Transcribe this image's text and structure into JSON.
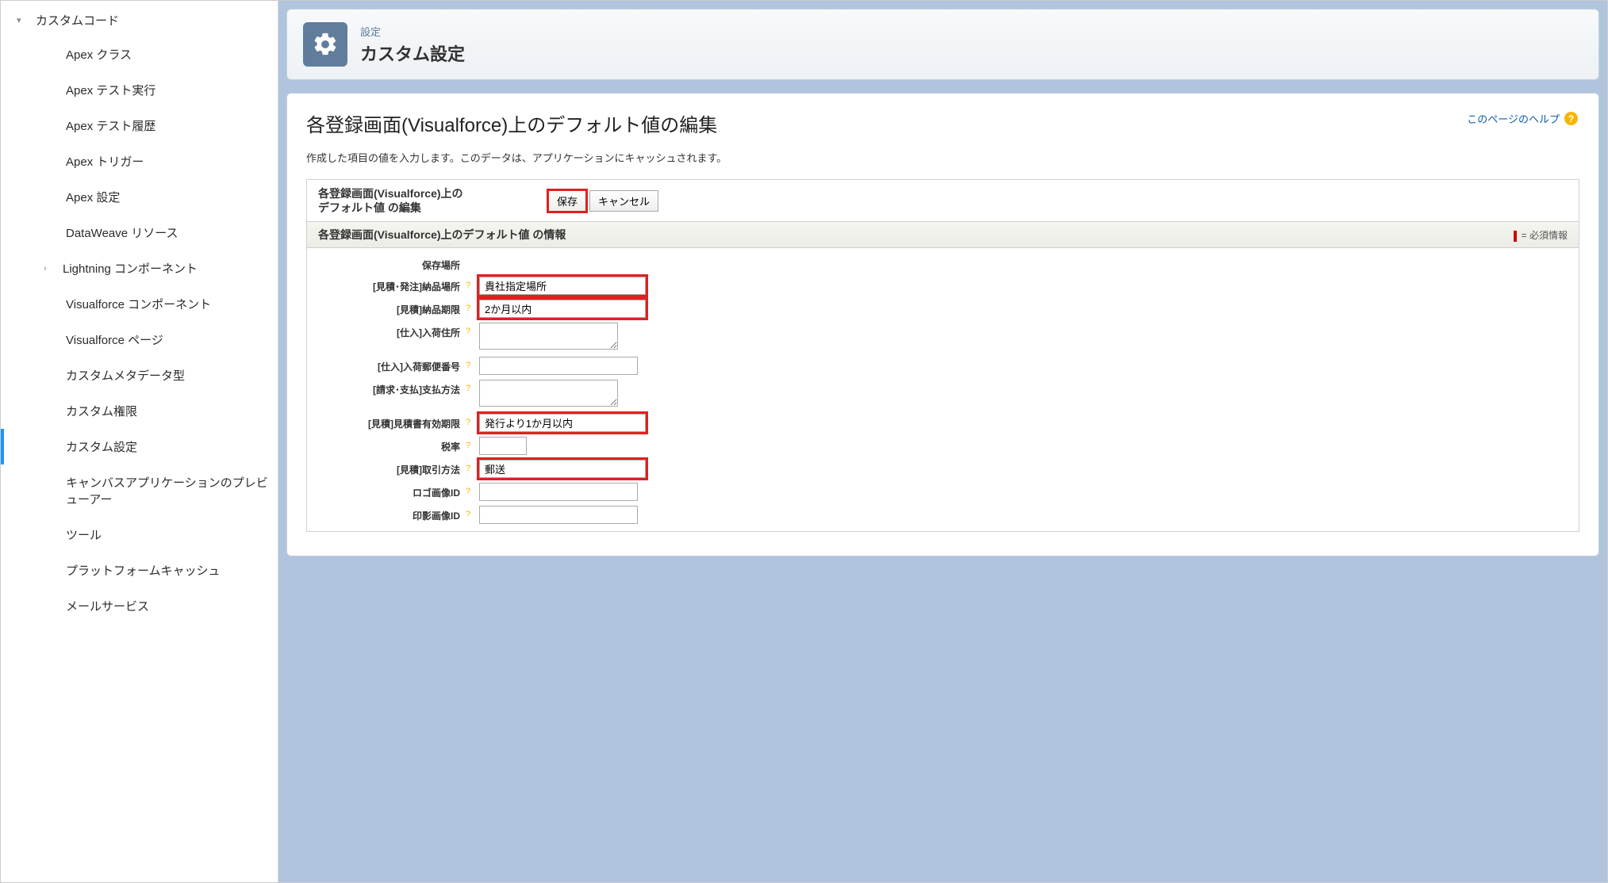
{
  "sidebar": {
    "parent": "カスタムコード",
    "items": [
      {
        "label": "Apex クラス"
      },
      {
        "label": "Apex テスト実行"
      },
      {
        "label": "Apex テスト履歴"
      },
      {
        "label": "Apex トリガー"
      },
      {
        "label": "Apex 設定"
      },
      {
        "label": "DataWeave リソース"
      },
      {
        "label": "Lightning コンポーネント",
        "hasChildren": true
      },
      {
        "label": "Visualforce コンポーネント"
      },
      {
        "label": "Visualforce ページ"
      },
      {
        "label": "カスタムメタデータ型"
      },
      {
        "label": "カスタム権限"
      },
      {
        "label": "カスタム設定",
        "selected": true
      },
      {
        "label": "キャンバスアプリケーションのプレビューアー"
      },
      {
        "label": "ツール"
      },
      {
        "label": "プラットフォームキャッシュ"
      },
      {
        "label": "メールサービス"
      }
    ]
  },
  "header": {
    "breadcrumb": "設定",
    "title": "カスタム設定"
  },
  "content": {
    "heading": "各登録画面(Visualforce)上のデフォルト値の編集",
    "helpLink": "このページのヘルプ",
    "description": "作成した項目の値を入力します。このデータは、アプリケーションにキャッシュされます。",
    "editHeaderLine1": "各登録画面(Visualforce)上の",
    "editHeaderLine2": "デフォルト値 の編集",
    "saveLabel": "保存",
    "cancelLabel": "キャンセル",
    "sectionTitle": "各登録画面(Visualforce)上のデフォルト値 の情報",
    "requiredLabel": "= 必須情報"
  },
  "form": {
    "location": {
      "label": "保存場所",
      "value": ""
    },
    "delivery_place": {
      "label": "[見積･発注]納品場所",
      "value": "貴社指定場所"
    },
    "delivery_due": {
      "label": "[見積]納品期限",
      "value": "2か月以内"
    },
    "arrival_addr": {
      "label": "[仕入]入荷住所",
      "value": ""
    },
    "arrival_zip": {
      "label": "[仕入]入荷郵便番号",
      "value": ""
    },
    "pay_method": {
      "label": "[請求･支払]支払方法",
      "value": ""
    },
    "quote_valid": {
      "label": "[見積]見積書有効期限",
      "value": "発行より1か月以内"
    },
    "tax_rate": {
      "label": "税率",
      "value": ""
    },
    "trade_method": {
      "label": "[見積]取引方法",
      "value": "郵送"
    },
    "logo_id": {
      "label": "ロゴ画像ID",
      "value": ""
    },
    "stamp_id": {
      "label": "印影画像ID",
      "value": ""
    }
  }
}
